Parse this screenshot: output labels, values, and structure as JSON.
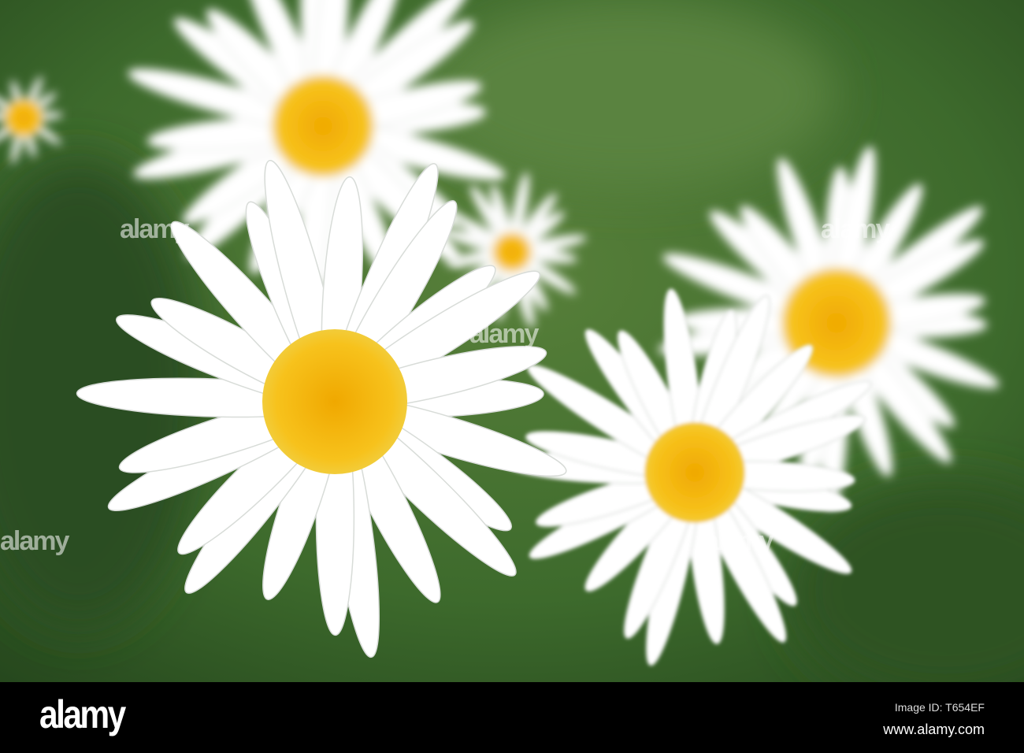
{
  "photo": {
    "subject": "white daisies with yellow centers on green background",
    "colors": {
      "background": "#3f6a2e",
      "petal": "#ffffff",
      "center": "#f5b80f"
    }
  },
  "watermark": {
    "text": "alamy"
  },
  "footer": {
    "logo": "alamy",
    "image_id": "Image ID: T654EF",
    "url": "www.alamy.com"
  }
}
